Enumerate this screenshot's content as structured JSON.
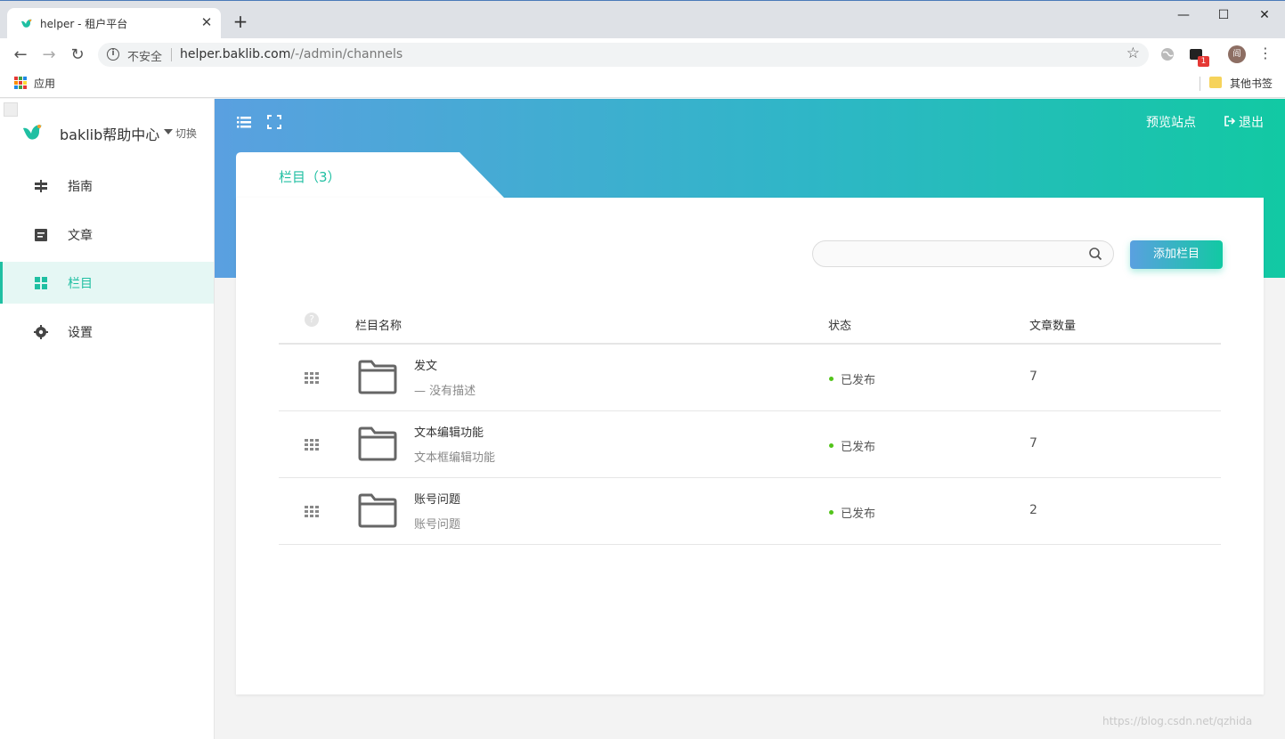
{
  "browser": {
    "tab_title": "helper - 租户平台",
    "new_tab": "+",
    "security_label": "不安全",
    "url_host": "helper.baklib.com",
    "url_path": "/-/admin/channels",
    "bookmarks": {
      "apps_label": "应用",
      "other_label": "其他书签"
    },
    "profile_initial": "阎",
    "ext_badge": "1"
  },
  "sidebar": {
    "brand": "baklib帮助中心",
    "switch_label": "切换",
    "items": [
      {
        "label": "指南",
        "icon": "signpost-icon",
        "active": false
      },
      {
        "label": "文章",
        "icon": "article-icon",
        "active": false
      },
      {
        "label": "栏目",
        "icon": "grid-icon",
        "active": true
      },
      {
        "label": "设置",
        "icon": "gear-icon",
        "active": false
      }
    ]
  },
  "header": {
    "preview_label": "预览站点",
    "logout_label": "退出"
  },
  "page": {
    "title": "栏目（3）",
    "search_placeholder": "",
    "add_button": "添加栏目",
    "columns": {
      "help": "?",
      "name": "栏目名称",
      "status": "状态",
      "count": "文章数量"
    },
    "rows": [
      {
        "name": "发文",
        "desc": "— 没有描述",
        "status": "已发布",
        "count": "7"
      },
      {
        "name": "文本编辑功能",
        "desc": "文本框编辑功能",
        "status": "已发布",
        "count": "7"
      },
      {
        "name": "账号问题",
        "desc": "账号问题",
        "status": "已发布",
        "count": "2"
      }
    ]
  },
  "watermark": "https://blog.csdn.net/qzhida",
  "colors": {
    "accent": "#1fbfa2",
    "gradient_start": "#5aa0e0",
    "gradient_end": "#12c9a3",
    "status_dot": "#52c41a"
  }
}
